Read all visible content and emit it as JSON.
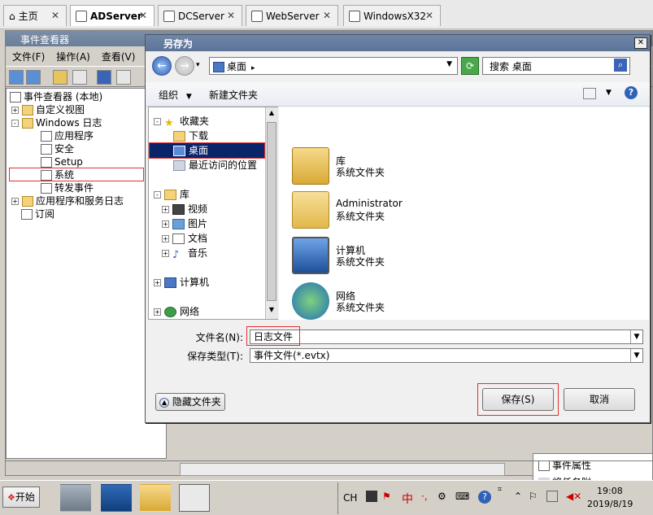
{
  "tabs": [
    {
      "label": "主页"
    },
    {
      "label": "ADServer"
    },
    {
      "label": "DCServer"
    },
    {
      "label": "WebServer"
    },
    {
      "label": "WindowsX32"
    }
  ],
  "event_viewer": {
    "title": "事件查看器",
    "menu": [
      "文件(F)",
      "操作(A)",
      "查看(V)"
    ],
    "tree": [
      {
        "label": "事件查看器 (本地)"
      },
      {
        "label": "自定义视图"
      },
      {
        "label": "Windows 日志"
      },
      {
        "label": "应用程序"
      },
      {
        "label": "安全"
      },
      {
        "label": "Setup"
      },
      {
        "label": "系统"
      },
      {
        "label": "转发事件"
      },
      {
        "label": "应用程序和服务日志"
      },
      {
        "label": "订阅"
      }
    ],
    "actions": [
      {
        "label": "事件属性"
      },
      {
        "label": "将任务附"
      }
    ]
  },
  "dialog": {
    "title": "另存为",
    "address": "桌面",
    "search_placeholder": "搜索 桌面",
    "organize_label": "组织",
    "new_folder_label": "新建文件夹",
    "nav": {
      "favorites": "收藏夹",
      "downloads": "下载",
      "desktop": "桌面",
      "recent": "最近访问的位置",
      "libraries": "库",
      "videos": "视频",
      "pictures": "图片",
      "documents": "文档",
      "music": "音乐",
      "computer": "计算机",
      "network": "网络"
    },
    "items": [
      {
        "name": "库",
        "type": "系统文件夹"
      },
      {
        "name": "Administrator",
        "type": "系统文件夹"
      },
      {
        "name": "计算机",
        "type": "系统文件夹"
      },
      {
        "name": "网络",
        "type": "系统文件夹"
      }
    ],
    "filename_label": "文件名(N):",
    "filename_value": "日志文件",
    "filetype_label": "保存类型(T):",
    "filetype_value": "事件文件(*.evtx)",
    "hide_folders_label": "隐藏文件夹",
    "save_label": "保存(S)",
    "cancel_label": "取消"
  },
  "taskbar": {
    "start_label": "开始",
    "lang": "CH",
    "ime": "中",
    "time": "19:08",
    "date": "2019/8/19"
  }
}
